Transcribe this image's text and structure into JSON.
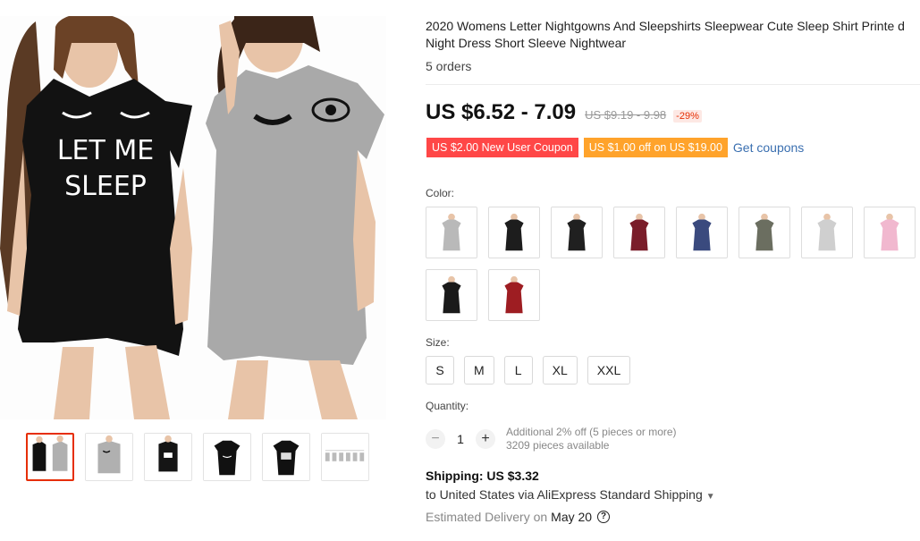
{
  "product": {
    "title": "2020 Womens Letter Nightgowns And Sleepshirts Sleepwear Cute Sleep Shirt Printe d Night Dress Short Sleeve Nightwear",
    "orders": "5 orders"
  },
  "price": {
    "current": "US $6.52 - 7.09",
    "original": "US $9.19 - 9.98",
    "discount": "-29%"
  },
  "coupons": {
    "new_user": "US $2.00 New User Coupon",
    "threshold": "US $1.00 off on US $19.00",
    "link": "Get coupons"
  },
  "color": {
    "label": "Color:",
    "options": [
      "gray",
      "black",
      "black",
      "wine-red",
      "navy-blue",
      "army-green",
      "light-gray",
      "pink",
      "black",
      "red"
    ],
    "swatch_colors": [
      "#b9b9b9",
      "#1d1d1d",
      "#202020",
      "#7a1d2a",
      "#3a4a7e",
      "#6b6e60",
      "#cfcfcf",
      "#f1b8cf",
      "#1a1a1a",
      "#9e1d22"
    ]
  },
  "size": {
    "label": "Size:",
    "options": [
      "S",
      "M",
      "L",
      "XL",
      "XXL"
    ]
  },
  "quantity": {
    "label": "Quantity:",
    "value": "1",
    "minus": "−",
    "plus": "+",
    "promo": "Additional 2% off (5 pieces or more)",
    "available": "3209 pieces available"
  },
  "shipping": {
    "title": "Shipping: US $3.32",
    "detail": "to United States via AliExpress Standard Shipping",
    "estimated_label": "Estimated Delivery on",
    "date": "May 20",
    "help_icon": "?"
  },
  "gallery": {
    "thumbnails": [
      "black-and-gray-pair",
      "gray-with-eyes",
      "black-sleep-print",
      "black-front",
      "black-letter-print",
      "size-chart"
    ]
  }
}
